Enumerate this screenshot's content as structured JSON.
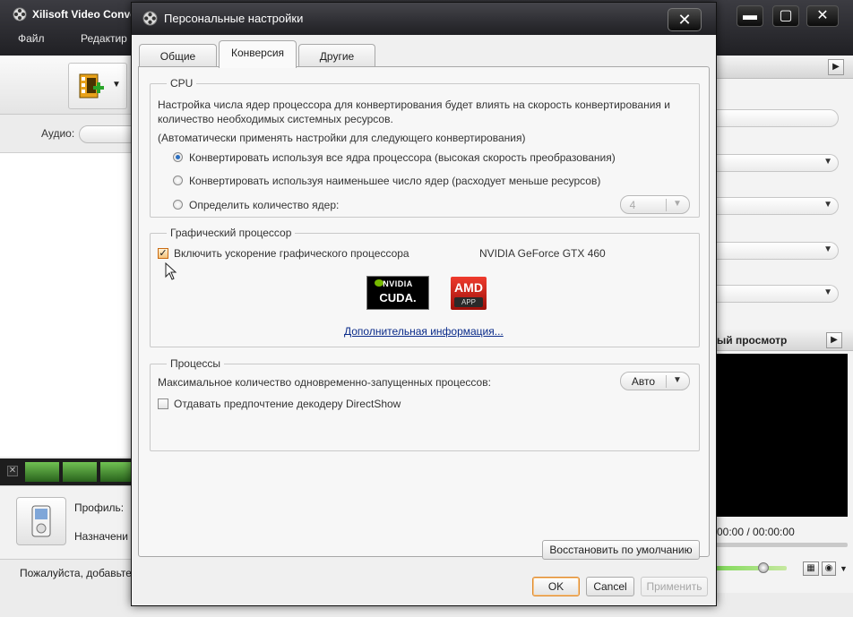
{
  "app": {
    "title": "Xilisoft Video Conve",
    "menu": [
      "Файл",
      "Редактир"
    ],
    "audio_label": "Аудио:",
    "profile_label": "Профиль:",
    "dest_label": "Назначени",
    "status_text": "Пожалуйста, добавьте",
    "preview_title": "ый просмотр",
    "time_readout": "00:00 / 00:00:00"
  },
  "dialog": {
    "title": "Персональные настройки",
    "tabs": [
      {
        "label": "Общие",
        "active": false
      },
      {
        "label": "Конверсия",
        "active": true
      },
      {
        "label": "Другие",
        "active": false
      }
    ],
    "cpu": {
      "legend": "CPU",
      "description_1": "Настройка числа ядер процессора для конвертирования будет влиять на скорость конвертирования и",
      "description_2": "количество необходимых системных ресурсов.",
      "note": "(Автоматически применять настройки для следующего конвертирования)",
      "options": [
        {
          "label": "Конвертировать используя все ядра процессора (высокая скорость преобразования)",
          "selected": true
        },
        {
          "label": "Конвертировать используя наименьшее число ядер (расходует меньше ресурсов)",
          "selected": false
        },
        {
          "label": "Определить количество ядер:",
          "selected": false
        }
      ],
      "cores_value": "4"
    },
    "gpu": {
      "legend": "Графический процессор",
      "enable_label": "Включить ускорение графического процессора",
      "enabled": true,
      "gpu_name": "NVIDIA GeForce GTX 460",
      "nvidia_logo_l1": "NVIDIA",
      "nvidia_logo_l2": "CUDA.",
      "amd_logo_l1": "AMD",
      "amd_logo_l2": "APP",
      "more_info_link": "Дополнительная информация..."
    },
    "processes": {
      "legend": "Процессы",
      "max_label": "Максимальное количество одновременно-запущенных процессов:",
      "max_value": "Авто",
      "directshow_label": "Отдавать предпочтение декодеру DirectShow",
      "directshow_checked": false
    },
    "buttons": {
      "restore_defaults": "Восстановить по умолчанию",
      "ok": "OK",
      "cancel": "Cancel",
      "apply": "Применить"
    }
  }
}
